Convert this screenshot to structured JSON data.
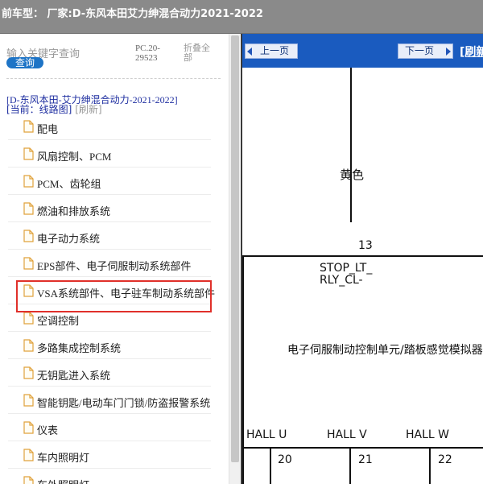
{
  "header": {
    "title": "前车型： 厂家:D-东风本田艾力绅混合动力2021-2022"
  },
  "sidebar": {
    "search_placeholder": "输入关键字查询",
    "query_button": "查询",
    "pc_code": "PC.20-29523",
    "collapse_all": "折叠全部",
    "tree_title": "[D-东风本田-艾力绅混合动力-2021-2022]",
    "current_prefix": "[当前：线路图]",
    "refresh_label": "[刷新]",
    "selected_item": "EPS部件、电子伺服制动系统部件",
    "items": [
      {
        "label": "配电"
      },
      {
        "label": "风扇控制、PCM"
      },
      {
        "label": "PCM、齿轮组"
      },
      {
        "label": "燃油和排放系统"
      },
      {
        "label": "电子动力系统"
      },
      {
        "label": "EPS部件、电子伺服制动系统部件"
      },
      {
        "label": "VSA系统部件、电子驻车制动系统部件"
      },
      {
        "label": "空调控制"
      },
      {
        "label": "多路集成控制系统"
      },
      {
        "label": "无钥匙进入系统"
      },
      {
        "label": "智能钥匙/电动车门门锁/防盗报警系统"
      },
      {
        "label": "仪表"
      },
      {
        "label": "车内照明灯"
      },
      {
        "label": "车外照明灯"
      }
    ]
  },
  "viewer": {
    "prev_label": "上一页",
    "next_label": "下一页",
    "refresh_label": "[刷新"
  },
  "diagram": {
    "wire_color_label": "黄色",
    "pin_top": "13",
    "stop_label_1": "STOP_LT_",
    "stop_label_2": "RLY_CL-",
    "unit_label": "电子伺服制动控制单元/踏板感觉模拟器",
    "hall_u": "HALL U",
    "hall_v": "HALL V",
    "hall_w": "HALL W",
    "pin_u": "20",
    "pin_v": "21",
    "pin_w": "22"
  },
  "colors": {
    "toolbar_blue": "#1a5bbf",
    "highlight_red": "#e0302a",
    "title_bar_gray": "#8a8a8a"
  }
}
